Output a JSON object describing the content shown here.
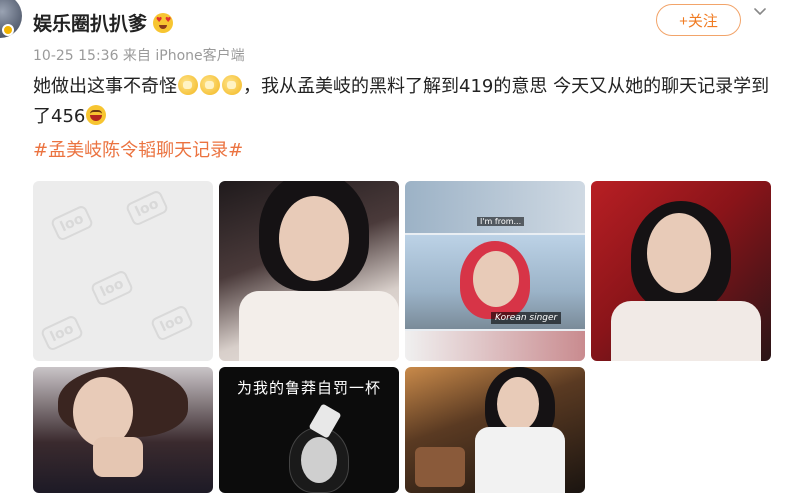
{
  "post": {
    "username": "娱乐圈扒扒爹",
    "meta": "10-25 15:36 来自 iPhone客户端",
    "follow_label": "+关注",
    "text_part1": "她做出这事不奇怪",
    "text_part2": "，我从孟美岐的黑料了解到419的意思 今天又从她的聊天记录学到了456",
    "hashtag": "#孟美岐陈令韬聊天记录#",
    "emojis": [
      "clap-emoji",
      "clap-emoji",
      "clap-emoji",
      "laugh-emoji"
    ]
  },
  "images": {
    "img3_caption_top": "I'm from...",
    "img3_caption_bottom": "Korean singer",
    "img6_caption": "为我的鲁莽自罚一杯"
  },
  "colors": {
    "follow_accent": "#f07b22",
    "hashtag": "#eb7340",
    "meta": "#9a9a9a"
  }
}
